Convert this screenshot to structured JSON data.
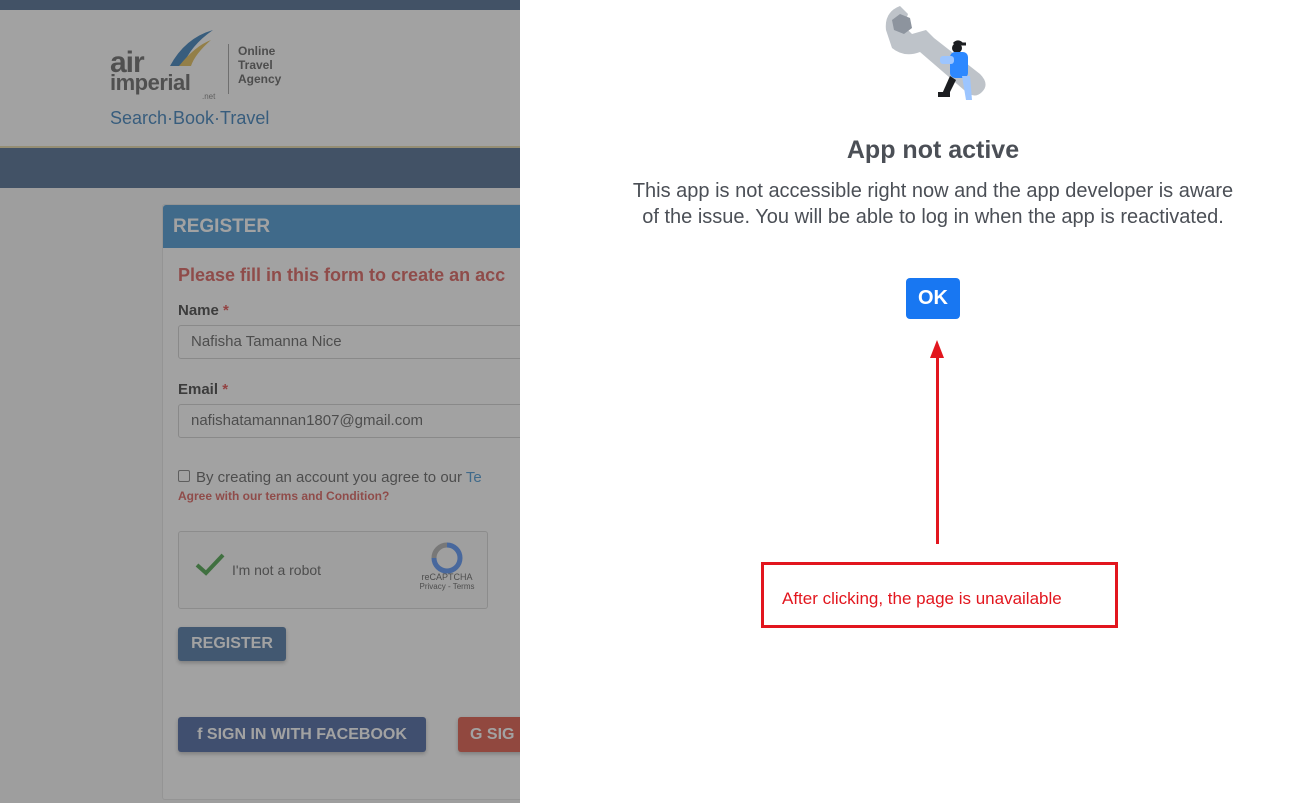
{
  "site": {
    "logo": {
      "air": "air",
      "imperial": "imperial",
      "net": ".net",
      "ota_line1": "Online",
      "ota_line2": "Travel",
      "ota_line3": "Agency",
      "tagline": "Search·Book·Travel"
    },
    "register": {
      "header": "REGISTER",
      "intro": "Please fill in this form to create an acc",
      "name_label": "Name",
      "name_value": "Nafisha Tamanna Nice",
      "email_label": "Email",
      "email_value": "nafishatamannan1807@gmail.com",
      "required_mark": "*",
      "agree_text": "By creating an account you agree to our",
      "agree_link": "Te",
      "agree_error": "Agree with our terms and Condition?",
      "captcha_text": "I'm not a robot",
      "captcha_brand": "reCAPTCHA",
      "captcha_links": "Privacy - Terms",
      "register_button": "REGISTER",
      "facebook_button": "SIGN IN WITH FACEBOOK",
      "google_button": "SIG"
    }
  },
  "dialog": {
    "title": "App not active",
    "message": "This app is not accessible right now and the app developer is aware of the issue. You will be able to log in when the app is reactivated.",
    "ok_button": "OK"
  },
  "annotation": {
    "text": "After clicking, the page is unavailable",
    "color": "#e2161e"
  },
  "colors": {
    "facebook_blue": "#1877f2",
    "nav_blue": "#3e5f86",
    "register_header": "#3b8fcf"
  }
}
